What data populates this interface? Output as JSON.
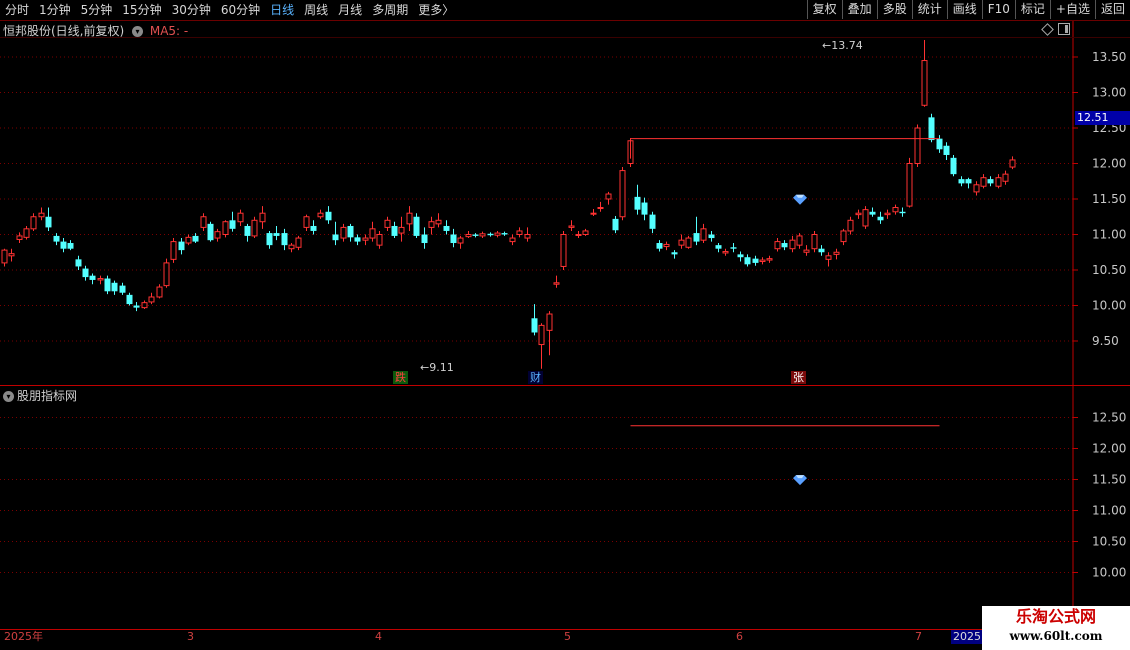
{
  "toolbar": {
    "periods": [
      "分时",
      "1分钟",
      "5分钟",
      "15分钟",
      "30分钟",
      "60分钟",
      "日线",
      "周线",
      "月线",
      "多周期",
      "更多"
    ],
    "active_period": "日线",
    "more_arrow": "〉",
    "buttons": [
      "复权",
      "叠加",
      "多股",
      "统计",
      "画线",
      "F10",
      "标记",
      "+自选",
      "返回"
    ]
  },
  "main_pane": {
    "stock_title": "恒邦股份(日线,前复权)",
    "ma_label": "MA5: -",
    "price_ticks": [
      "13.50",
      "13.00",
      "12.50",
      "12.00",
      "11.50",
      "11.00",
      "10.50",
      "10.00",
      "9.50"
    ],
    "current_price": "12.51",
    "high_annotation": "13.74",
    "low_annotation": "9.11"
  },
  "indicator_pane": {
    "title": "股朋指标网",
    "price_ticks": [
      "12.50",
      "12.00",
      "11.50",
      "11.00",
      "10.50",
      "10.00"
    ]
  },
  "markers": {
    "die": "跌",
    "cai": "财",
    "zhang": "张"
  },
  "date_axis": {
    "labels": [
      "2025年",
      "3",
      "4",
      "5",
      "6",
      "7"
    ],
    "year_box": "2025"
  },
  "watermark": {
    "title": "乐淘公式网",
    "url": "www.60lt.com"
  },
  "colors": {
    "up": "#ff3232",
    "down": "#54ffff",
    "grid": "#7a0000",
    "axis": "#c00000",
    "gem": "#5aa0ff"
  },
  "chart_data": {
    "type": "candlestick",
    "ylim": [
      9.0,
      14.0
    ],
    "x": [
      "c01",
      "c02",
      "c03",
      "c04",
      "c05",
      "c06",
      "c07",
      "c08",
      "c09",
      "c10",
      "c11",
      "c12",
      "c13",
      "c14",
      "c15",
      "c16",
      "c17",
      "c18",
      "c19",
      "c20",
      "c21",
      "c22",
      "c23",
      "c24",
      "c25",
      "c26",
      "c27",
      "c28",
      "c29",
      "c30",
      "c31",
      "c32",
      "c33",
      "c34",
      "c35",
      "c36",
      "c37",
      "c38",
      "c39",
      "c40",
      "c41",
      "c42",
      "c43",
      "c44",
      "c45",
      "c46",
      "c47",
      "c48",
      "c49",
      "c50",
      "c51",
      "c52",
      "c53",
      "c54",
      "c55",
      "c56",
      "c57",
      "c58",
      "c59",
      "c60",
      "c61",
      "c62",
      "c63",
      "c64",
      "c65",
      "c66",
      "c67",
      "c68",
      "c69",
      "c70",
      "c71",
      "c72",
      "c73",
      "c74",
      "c75",
      "c76",
      "c77",
      "c78",
      "c79",
      "c80",
      "c81",
      "c82",
      "c83",
      "c84",
      "c85",
      "c86",
      "c87",
      "c88",
      "c89",
      "c90",
      "c91",
      "c92",
      "c93",
      "c94",
      "c95",
      "c96",
      "c97",
      "c98",
      "c99",
      "c100",
      "c101",
      "c102",
      "c103",
      "c104",
      "c105",
      "c106",
      "c107",
      "c108",
      "c109",
      "c110",
      "c111",
      "c112",
      "c113",
      "c114",
      "c115",
      "c116",
      "c117",
      "c118",
      "c119",
      "c120",
      "c121",
      "c122",
      "c123",
      "c124",
      "c125",
      "c126",
      "c127",
      "c128",
      "c129",
      "c130",
      "c131",
      "c132",
      "c133",
      "c134",
      "c135",
      "c136",
      "c137",
      "c138",
      "c139",
      "c140",
      "c141",
      "c142",
      "c143"
    ],
    "candles": [
      [
        10.6,
        10.78,
        10.55,
        10.8
      ],
      [
        10.7,
        10.73,
        10.62,
        10.8
      ],
      [
        10.93,
        10.98,
        10.88,
        11.03
      ],
      [
        10.96,
        11.08,
        10.93,
        11.12
      ],
      [
        11.08,
        11.25,
        11.05,
        11.3
      ],
      [
        11.25,
        11.3,
        11.2,
        11.38
      ],
      [
        11.25,
        11.1,
        11.05,
        11.38
      ],
      [
        10.98,
        10.9,
        10.85,
        11.02
      ],
      [
        10.9,
        10.8,
        10.75,
        10.95
      ],
      [
        10.88,
        10.8,
        10.78,
        10.92
      ],
      [
        10.65,
        10.55,
        10.5,
        10.7
      ],
      [
        10.52,
        10.4,
        10.35,
        10.56
      ],
      [
        10.42,
        10.36,
        10.3,
        10.45
      ],
      [
        10.36,
        10.38,
        10.3,
        10.42
      ],
      [
        10.38,
        10.2,
        10.16,
        10.42
      ],
      [
        10.32,
        10.2,
        10.15,
        10.35
      ],
      [
        10.28,
        10.18,
        10.15,
        10.32
      ],
      [
        10.15,
        10.02,
        10.0,
        10.18
      ],
      [
        10.0,
        9.97,
        9.92,
        10.05
      ],
      [
        9.97,
        10.04,
        9.95,
        10.07
      ],
      [
        10.05,
        10.12,
        10.02,
        10.18
      ],
      [
        10.12,
        10.26,
        10.1,
        10.3
      ],
      [
        10.28,
        10.6,
        10.25,
        10.66
      ],
      [
        10.65,
        10.9,
        10.6,
        10.95
      ],
      [
        10.9,
        10.78,
        10.72,
        10.95
      ],
      [
        10.88,
        10.96,
        10.85,
        11.0
      ],
      [
        10.98,
        10.9,
        10.88,
        11.02
      ],
      [
        11.1,
        11.25,
        11.05,
        11.3
      ],
      [
        11.15,
        10.92,
        10.9,
        11.18
      ],
      [
        10.95,
        11.04,
        10.9,
        11.08
      ],
      [
        11.0,
        11.18,
        10.96,
        11.2
      ],
      [
        11.2,
        11.08,
        11.04,
        11.32
      ],
      [
        11.18,
        11.3,
        11.12,
        11.35
      ],
      [
        11.12,
        10.98,
        10.9,
        11.15
      ],
      [
        10.98,
        11.2,
        10.95,
        11.25
      ],
      [
        11.18,
        11.3,
        11.08,
        11.4
      ],
      [
        11.02,
        10.85,
        10.8,
        11.05
      ],
      [
        11.02,
        10.98,
        10.92,
        11.12
      ],
      [
        11.02,
        10.85,
        10.78,
        11.08
      ],
      [
        10.8,
        10.85,
        10.75,
        10.88
      ],
      [
        10.82,
        10.95,
        10.78,
        10.98
      ],
      [
        11.1,
        11.25,
        11.05,
        11.28
      ],
      [
        11.12,
        11.05,
        11.0,
        11.2
      ],
      [
        11.25,
        11.3,
        11.22,
        11.35
      ],
      [
        11.32,
        11.2,
        11.15,
        11.4
      ],
      [
        11.0,
        10.92,
        10.85,
        11.18
      ],
      [
        10.95,
        11.1,
        10.9,
        11.15
      ],
      [
        11.12,
        10.96,
        10.9,
        11.15
      ],
      [
        10.96,
        10.9,
        10.85,
        11.0
      ],
      [
        10.92,
        10.95,
        10.85,
        11.0
      ],
      [
        10.95,
        11.08,
        10.9,
        11.18
      ],
      [
        10.85,
        11.0,
        10.8,
        11.05
      ],
      [
        11.1,
        11.2,
        11.05,
        11.25
      ],
      [
        11.12,
        10.98,
        10.95,
        11.18
      ],
      [
        11.02,
        11.1,
        10.9,
        11.25
      ],
      [
        11.15,
        11.3,
        11.05,
        11.4
      ],
      [
        11.25,
        10.98,
        10.95,
        11.3
      ],
      [
        11.0,
        10.88,
        10.8,
        11.1
      ],
      [
        11.1,
        11.18,
        11.0,
        11.25
      ],
      [
        11.15,
        11.2,
        11.1,
        11.3
      ],
      [
        11.12,
        11.05,
        11.0,
        11.2
      ],
      [
        11.0,
        10.88,
        10.82,
        11.08
      ],
      [
        10.88,
        10.95,
        10.8,
        10.98
      ],
      [
        10.97,
        11.0,
        10.95,
        11.05
      ],
      [
        11.0,
        10.98,
        10.96,
        11.02
      ],
      [
        10.98,
        11.01,
        10.95,
        11.04
      ],
      [
        11.01,
        10.99,
        10.97,
        11.03
      ],
      [
        10.99,
        11.02,
        10.96,
        11.05
      ],
      [
        11.02,
        11.0,
        10.98,
        11.04
      ],
      [
        10.9,
        10.95,
        10.85,
        11.0
      ],
      [
        11.0,
        11.05,
        10.96,
        11.1
      ],
      [
        10.95,
        11.0,
        10.9,
        11.1
      ],
      [
        9.82,
        9.62,
        9.58,
        10.02
      ],
      [
        9.45,
        9.72,
        9.11,
        9.75
      ],
      [
        9.65,
        9.88,
        9.3,
        9.92
      ],
      [
        10.3,
        10.32,
        10.25,
        10.42
      ],
      [
        10.55,
        11.0,
        10.5,
        11.05
      ],
      [
        11.1,
        11.12,
        11.05,
        11.2
      ],
      [
        11.0,
        11.0,
        10.95,
        11.05
      ],
      [
        11.0,
        11.05,
        10.98,
        11.08
      ],
      [
        11.3,
        11.3,
        11.26,
        11.36
      ],
      [
        11.38,
        11.38,
        11.32,
        11.46
      ],
      [
        11.5,
        11.57,
        11.42,
        11.6
      ],
      [
        11.22,
        11.06,
        11.02,
        11.26
      ],
      [
        11.25,
        11.9,
        11.2,
        11.95
      ],
      [
        12.0,
        12.32,
        11.95,
        12.36
      ],
      [
        11.53,
        11.35,
        11.28,
        11.7
      ],
      [
        11.45,
        11.28,
        11.2,
        11.52
      ],
      [
        11.28,
        11.08,
        11.02,
        11.32
      ],
      [
        10.88,
        10.8,
        10.76,
        10.92
      ],
      [
        10.83,
        10.86,
        10.78,
        10.9
      ],
      [
        10.75,
        10.72,
        10.66,
        10.78
      ],
      [
        10.85,
        10.92,
        10.8,
        11.0
      ],
      [
        10.82,
        10.95,
        10.8,
        10.98
      ],
      [
        11.02,
        10.9,
        10.85,
        11.25
      ],
      [
        10.92,
        11.08,
        10.88,
        11.15
      ],
      [
        11.0,
        10.95,
        10.9,
        11.05
      ],
      [
        10.85,
        10.8,
        10.75,
        10.88
      ],
      [
        10.74,
        10.76,
        10.7,
        10.8
      ],
      [
        10.82,
        10.8,
        10.75,
        10.88
      ],
      [
        10.72,
        10.68,
        10.62,
        10.76
      ],
      [
        10.68,
        10.58,
        10.55,
        10.72
      ],
      [
        10.66,
        10.6,
        10.56,
        10.7
      ],
      [
        10.62,
        10.64,
        10.58,
        10.68
      ],
      [
        10.64,
        10.66,
        10.6,
        10.7
      ],
      [
        10.8,
        10.9,
        10.76,
        10.95
      ],
      [
        10.88,
        10.82,
        10.78,
        10.92
      ],
      [
        10.8,
        10.92,
        10.75,
        10.98
      ],
      [
        10.85,
        10.98,
        10.8,
        11.02
      ],
      [
        10.75,
        10.78,
        10.7,
        10.85
      ],
      [
        10.8,
        11.0,
        10.75,
        11.05
      ],
      [
        10.8,
        10.75,
        10.7,
        10.85
      ],
      [
        10.65,
        10.7,
        10.55,
        10.75
      ],
      [
        10.72,
        10.75,
        10.65,
        10.8
      ],
      [
        10.9,
        11.05,
        10.85,
        11.08
      ],
      [
        11.05,
        11.2,
        11.0,
        11.25
      ],
      [
        11.28,
        11.3,
        11.22,
        11.35
      ],
      [
        11.12,
        11.35,
        11.08,
        11.4
      ],
      [
        11.32,
        11.28,
        11.25,
        11.38
      ],
      [
        11.25,
        11.2,
        11.15,
        11.32
      ],
      [
        11.28,
        11.3,
        11.22,
        11.35
      ],
      [
        11.32,
        11.38,
        11.28,
        11.42
      ],
      [
        11.32,
        11.3,
        11.25,
        11.38
      ],
      [
        11.4,
        12.0,
        11.38,
        12.08
      ],
      [
        12.0,
        12.5,
        11.95,
        12.55
      ],
      [
        12.82,
        13.45,
        12.8,
        13.74
      ],
      [
        12.65,
        12.33,
        12.3,
        12.7
      ],
      [
        12.35,
        12.2,
        12.15,
        12.4
      ],
      [
        12.25,
        12.12,
        12.05,
        12.3
      ],
      [
        12.08,
        11.85,
        11.82,
        12.12
      ],
      [
        11.78,
        11.72,
        11.68,
        11.82
      ],
      [
        11.78,
        11.72,
        11.65,
        11.8
      ],
      [
        11.6,
        11.7,
        11.55,
        11.75
      ],
      [
        11.68,
        11.8,
        11.65,
        11.85
      ],
      [
        11.78,
        11.72,
        11.68,
        11.82
      ],
      [
        11.68,
        11.8,
        11.65,
        11.85
      ],
      [
        11.75,
        11.85,
        11.7,
        11.9
      ],
      [
        11.95,
        12.05,
        11.92,
        12.1
      ]
    ],
    "guide_line": {
      "price": 12.35,
      "from_index": 85,
      "to_index": 127
    },
    "gem_price": 11.49
  }
}
